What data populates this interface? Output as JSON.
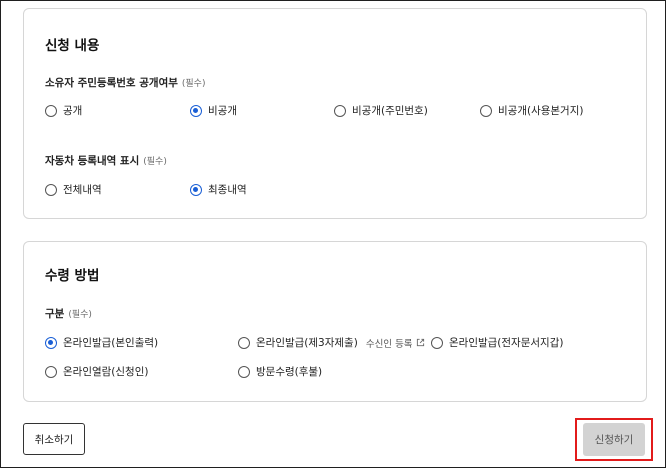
{
  "apply_section": {
    "title": "신청 내용",
    "owner_id_field": {
      "label": "소유자 주민등록번호 공개여부",
      "required": "(필수)",
      "options": [
        {
          "label": "공개",
          "selected": false
        },
        {
          "label": "비공개",
          "selected": true
        },
        {
          "label": "비공개(주민번호)",
          "selected": false
        },
        {
          "label": "비공개(사용본거지)",
          "selected": false
        }
      ]
    },
    "history_field": {
      "label": "자동차 등록내역 표시",
      "required": "(필수)",
      "options": [
        {
          "label": "전체내역",
          "selected": false
        },
        {
          "label": "최종내역",
          "selected": true
        }
      ]
    }
  },
  "receipt_section": {
    "title": "수령 방법",
    "type_field": {
      "label": "구분",
      "required": "(필수)",
      "options": [
        {
          "label": "온라인발급(본인출력)",
          "selected": true
        },
        {
          "label": "온라인발급(제3자제출)",
          "selected": false,
          "extra": "수신인 등록"
        },
        {
          "label": "온라인발급(전자문서지갑)",
          "selected": false
        },
        {
          "label": "온라인열람(신청인)",
          "selected": false
        },
        {
          "label": "방문수령(후불)",
          "selected": false
        }
      ]
    }
  },
  "buttons": {
    "cancel": "취소하기",
    "submit": "신청하기"
  },
  "colors": {
    "accent": "#1a5fd6",
    "highlight": "#e21b1b",
    "submit_bg": "#d3d3d3"
  }
}
